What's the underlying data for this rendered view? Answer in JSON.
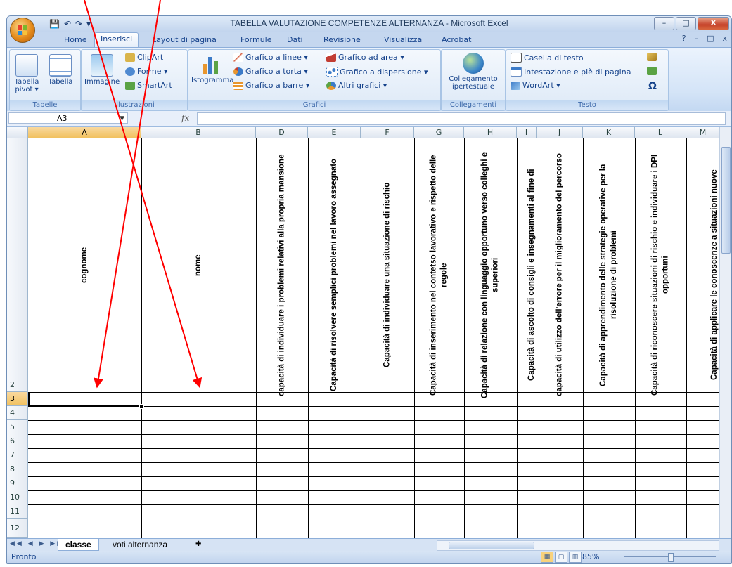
{
  "window": {
    "title": "TABELLA VALUTAZIONE COMPETENZE  ALTERNANZA - Microsoft Excel",
    "controls": [
      "–",
      "□",
      "X"
    ]
  },
  "qat": [
    "💾",
    "↶",
    "↷",
    "▾"
  ],
  "tabs": [
    "Home",
    "Inserisci",
    "Layout di pagina",
    "Formule",
    "Dati",
    "Revisione",
    "Visualizza",
    "Acrobat"
  ],
  "active_tab": "Inserisci",
  "ribbon": {
    "tabelle": {
      "name": "Tabelle",
      "pivot": "Tabella pivot ▾",
      "tabella": "Tabella"
    },
    "illustrazioni": {
      "name": "Illustrazioni",
      "immagine": "Immagine",
      "clipart": "ClipArt",
      "forme": "Forme ▾",
      "smartart": "SmartArt"
    },
    "grafici": {
      "name": "Grafici",
      "istogramma": "Istogramma",
      "linee": "Grafico a linee ▾",
      "torta": "Grafico a torta ▾",
      "barre": "Grafico a barre ▾",
      "area": "Grafico ad area ▾",
      "dispersione": "Grafico a dispersione ▾",
      "altri": "Altri grafici ▾"
    },
    "collegamenti": {
      "name": "Collegamenti",
      "collegamento": "Collegamento ipertestuale"
    },
    "testo": {
      "name": "Testo",
      "casella": "Casella di testo",
      "intestazione": "Intestazione e piè di pagina",
      "wordart": "WordArt ▾",
      "omega": "Ω"
    }
  },
  "formula_bar": {
    "name_box": "A3",
    "fx": "fx",
    "formula": ""
  },
  "columns": [
    "A",
    "B",
    "D",
    "E",
    "F",
    "G",
    "H",
    "I",
    "J",
    "K",
    "L",
    "M"
  ],
  "rows": [
    "2",
    "3",
    "4",
    "5",
    "6",
    "7",
    "8",
    "9",
    "10",
    "11",
    "12"
  ],
  "headers": [
    "cognome",
    "nome",
    "capacità di individuare i problemi relativi alla propria mansione",
    "Capacità di risolvere semplici problemi nel lavoro assegnato",
    "Capacità di individuare una situazione di rischio",
    "Capacità di inserimento nel contetso lavorativo e rispetto delle regole",
    "Capacità di relazione con linguaggio opportuno verso colleghi e superiori",
    "Capacità di ascolto di consigli e insegnamenti al fine di",
    "capacità di utilizzo dell'errore per il miglioramento del percorso",
    "Capacità di apprendimento delle strategie operative per la risoluzione di problemi",
    "Capacità di riconoscere situazioni di rischio e individuare i DPI opportuni",
    "Capacità di applicare le conoscenze a situazioni nuove"
  ],
  "sheets": [
    "classe",
    "voti alternanza"
  ],
  "active_sheet": "classe",
  "status": {
    "text": "Pronto",
    "zoom": "85%"
  },
  "colors": {
    "accent": "#15428b",
    "arrow": "#ff0000",
    "selection": "#f1c15f"
  }
}
